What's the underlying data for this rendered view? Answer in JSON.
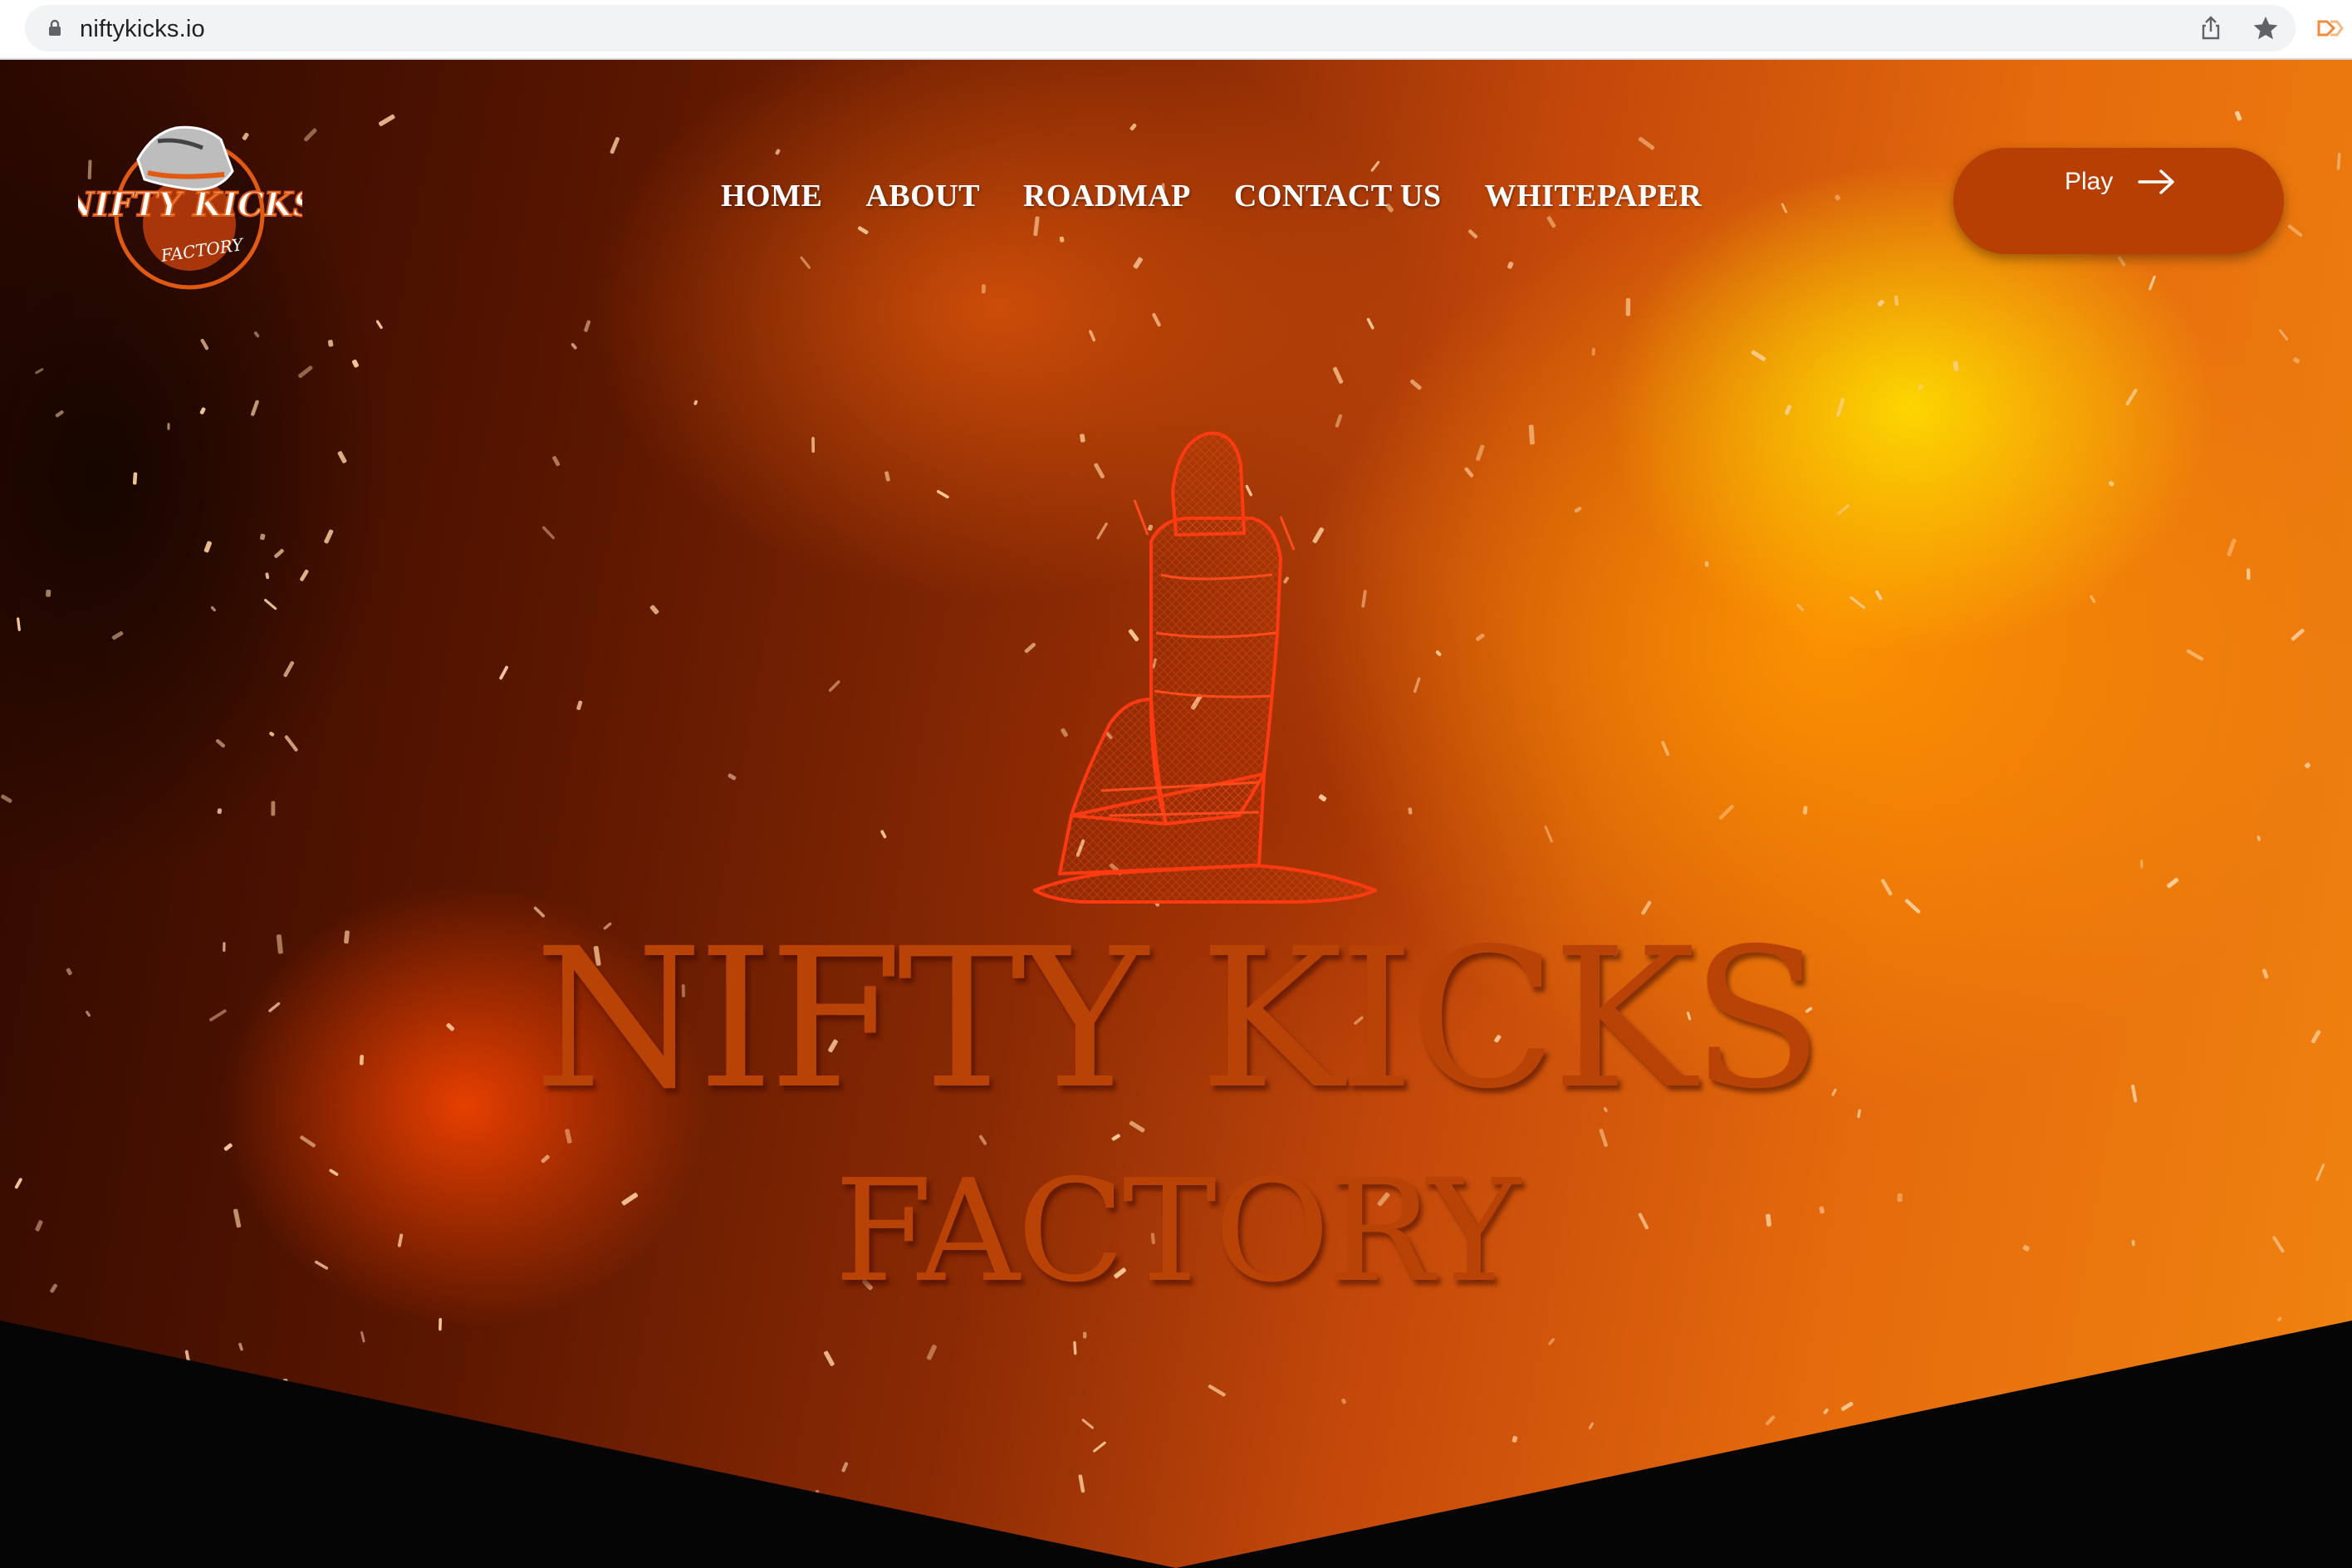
{
  "browser": {
    "url": "niftykicks.io",
    "icons": [
      "lock-icon",
      "share-icon",
      "star-icon",
      "extension-icon"
    ]
  },
  "site": {
    "logo": {
      "line1": "NIFTY KICKS",
      "line2": "FACTORY"
    },
    "nav": [
      {
        "label": "HOME"
      },
      {
        "label": "ABOUT"
      },
      {
        "label": "ROADMAP"
      },
      {
        "label": "CONTACT US"
      },
      {
        "label": "WHITEPAPER"
      }
    ],
    "cta": {
      "label": "Play",
      "icon": "arrow-right-icon"
    },
    "hero": {
      "title_line1": "NIFTY KICKS",
      "title_line2": "FACTORY"
    }
  },
  "colors": {
    "accent": "#b83f04",
    "title": "#b94207",
    "spark": "#ffd2a0",
    "wireframe": "#ff3a10"
  }
}
